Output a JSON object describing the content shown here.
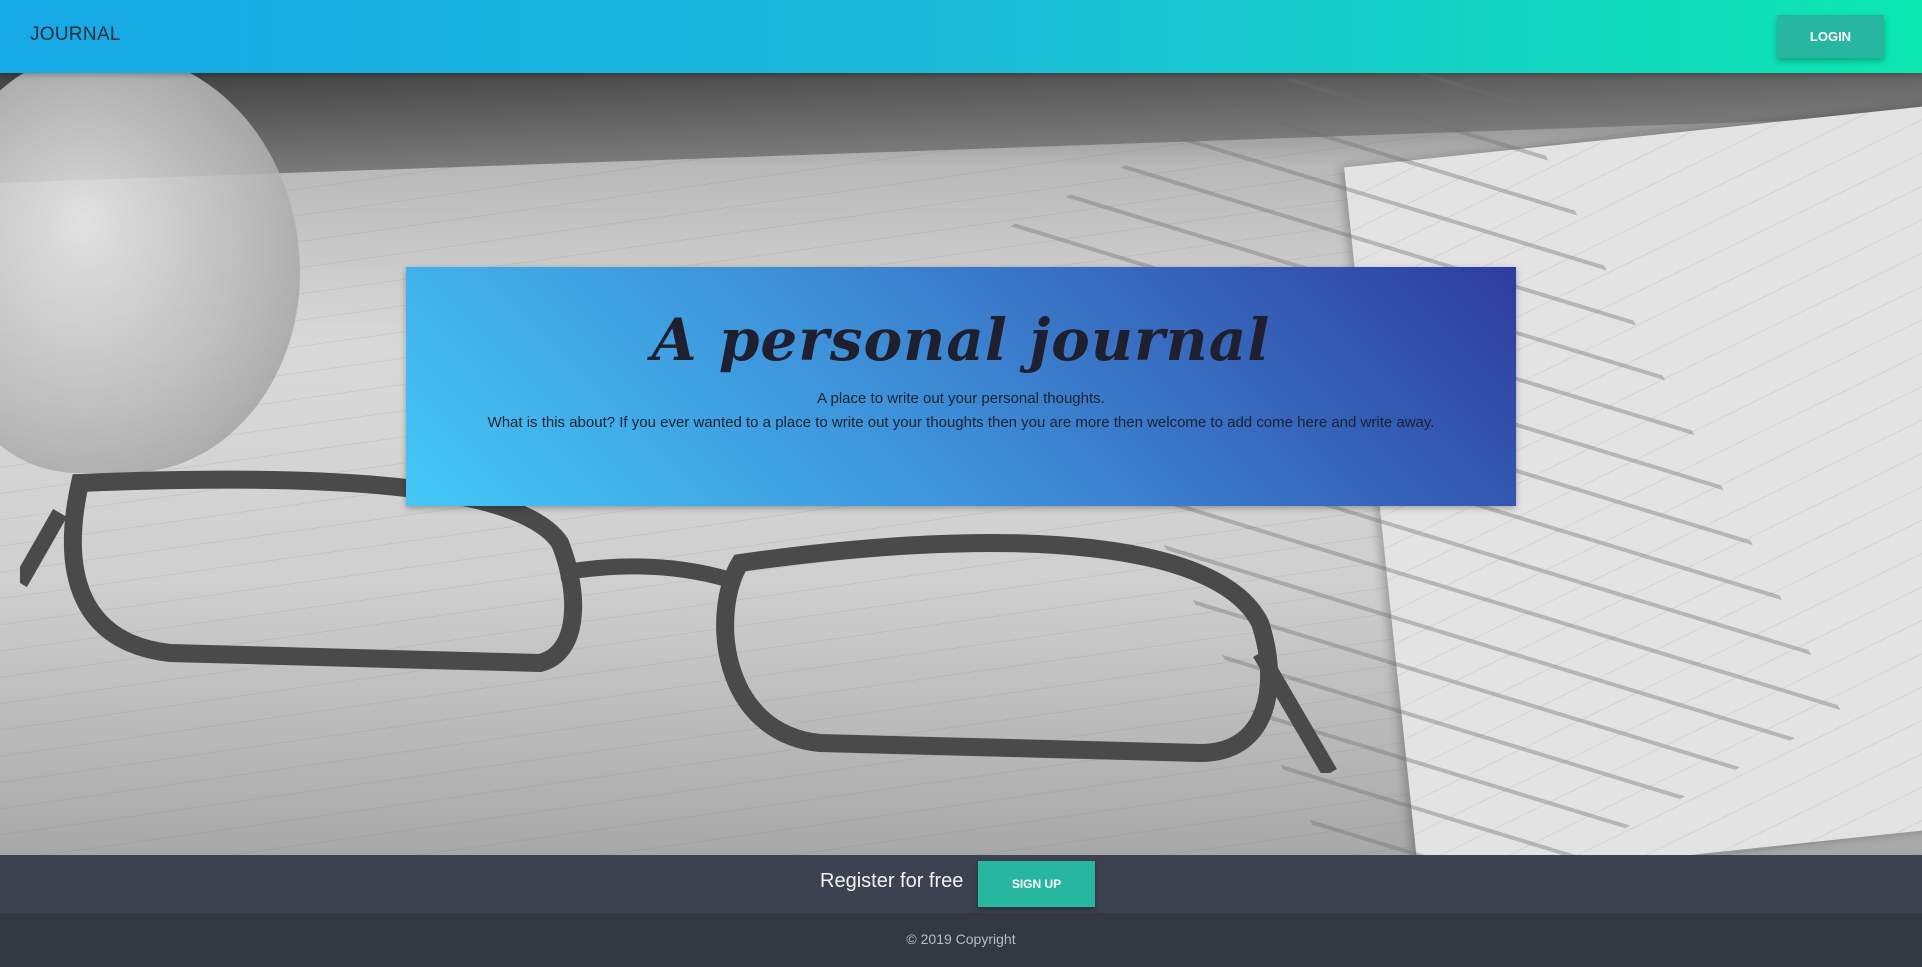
{
  "navbar": {
    "brand": "JOURNAL",
    "login_label": "LOGIN",
    "gradient_start": "#15a9e6",
    "gradient_end": "#0ce8b0"
  },
  "hero": {
    "image": "notebook-with-glasses-photo",
    "card": {
      "title": "A personal journal",
      "line1": "A place to write out your personal thoughts.",
      "line2": "What is this about? If you ever wanted to a place to write out your thoughts then you are more then welcome to add come here and write away."
    }
  },
  "register": {
    "label": "Register for free",
    "signup_label": "SIGN UP",
    "button_color": "#27b6a0"
  },
  "footer": {
    "copyright": "© 2019 Copyright"
  }
}
